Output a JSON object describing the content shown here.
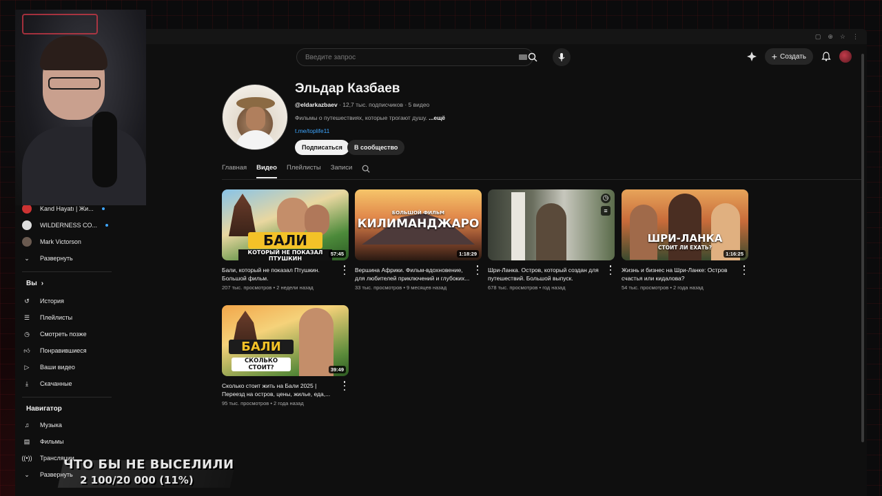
{
  "header": {
    "search_placeholder": "Введите запрос",
    "create_label": "Создать"
  },
  "sidebar": {
    "subscriptions": [
      {
        "label": "Kand Hayatı | Жи...",
        "new": true
      },
      {
        "label": "WILDERNESS CO...",
        "new": true
      },
      {
        "label": "Mark Victorson",
        "new": false
      }
    ],
    "expand_label": "Развернуть",
    "you_title": "Вы",
    "you_items": [
      {
        "label": "История",
        "icon": "history-icon"
      },
      {
        "label": "Плейлисты",
        "icon": "playlists-icon"
      },
      {
        "label": "Смотреть позже",
        "icon": "watch-later-icon"
      },
      {
        "label": "Понравившиеся",
        "icon": "thumb-up-icon"
      },
      {
        "label": "Ваши видео",
        "icon": "your-videos-icon"
      },
      {
        "label": "Скачанные",
        "icon": "download-icon"
      }
    ],
    "navigator_title": "Навигатор",
    "navigator_items": [
      {
        "label": "Музыка",
        "icon": "music-icon"
      },
      {
        "label": "Фильмы",
        "icon": "films-icon"
      },
      {
        "label": "Трансляции",
        "icon": "live-icon"
      },
      {
        "label": "Развернуть",
        "icon": "chevron-down-icon"
      }
    ]
  },
  "channel": {
    "name": "Эльдар Казбаев",
    "handle": "@eldarkazbaev",
    "stats": " · 12,7 тыс. подписчиков · 5 видео",
    "description": "Фильмы о путешествиях, которые трогают душу. ",
    "more": "...ещё",
    "link": "t.me/toplife11",
    "subscribe_label": "Подписаться",
    "community_label": "В сообщество"
  },
  "tabs": [
    "Главная",
    "Видео",
    "Плейлисты",
    "Записи"
  ],
  "active_tab": "Видео",
  "videos": [
    {
      "title": "Бали, который не показал Птушкин. Большой фильм.",
      "meta": "207 тыс. просмотров • 2 недели назад",
      "duration": "57:45",
      "thumb_text": "БАЛИ",
      "thumb_sub": "КОТОРЫЙ НЕ ПОКАЗАЛ ПТУШКИН"
    },
    {
      "title": "Вершина Африки. Фильм-вдохновение, для любителей приключений и глубоких...",
      "meta": "33 тыс. просмотров • 9 месяцев назад",
      "duration": "1:18:29",
      "thumb_text": "КИЛИМАНДЖАРО",
      "thumb_sub": "БОЛЬШОЙ ФИЛЬМ"
    },
    {
      "title": "Шри-Ланка. Остров, который создан для путешествий. Большой выпуск.",
      "meta": "678 тыс. просмотров • год назад",
      "duration": "",
      "thumb_text": "",
      "thumb_sub": ""
    },
    {
      "title": "Жизнь и бизнес на Шри-Ланке: Остров счастья или кидалова?",
      "meta": "54 тыс. просмотров • 2 года назад",
      "duration": "1:16:25",
      "thumb_text": "ШРИ-ЛАНКА",
      "thumb_sub": "СТОИТ ЛИ ЕХАТЬ?"
    },
    {
      "title": "Сколько стоит жить на Бали 2025 | Переезд на остров, цены, жилье, еда,...",
      "meta": "95 тыс. просмотров • 2 года назад",
      "duration": "39:49",
      "thumb_text": "БАЛИ",
      "thumb_sub": "СКОЛЬКО СТОИТ?"
    }
  ],
  "overlay": {
    "line1": "ЧТО БЫ НЕ ВЫСЕЛИЛИ",
    "line2": "2 100/20 000 (11%)"
  },
  "colors": {
    "accent_link": "#3ea6ff",
    "background": "#0f0f0f",
    "stream_red": "#c0202c"
  }
}
